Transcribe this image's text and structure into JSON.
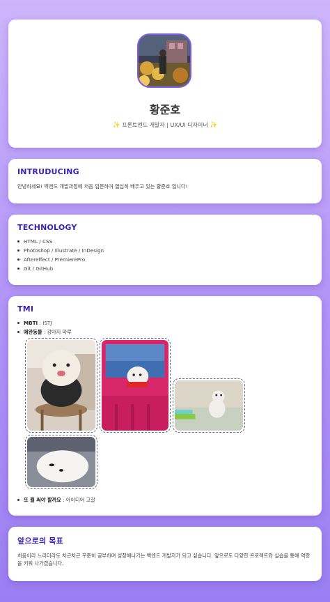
{
  "profile": {
    "name": "황준호",
    "role": "프론트엔드 개발자 | UX/UI 디자이너",
    "spark": "✨"
  },
  "intro": {
    "title": "INTRUDUCING",
    "text": "안녕하세요! 백엔드 개발과정에 처음 입문하여 열심히 배우고 있는 황준호 입니다!"
  },
  "technology": {
    "title": "TECHNOLOGY",
    "items": [
      "HTML / CSS",
      "Photoshop / Illustrate / InDesign",
      "Aftereffect / PremierePro",
      "Git / GitHub"
    ]
  },
  "tmi": {
    "title": "TMI",
    "mbti_label": "MBTI",
    "mbti_value": " : ISTJ",
    "pet_label": "애완동물",
    "pet_value": " : 강아지 마루",
    "next_label": "또 뭘 써야 할까요",
    "next_value": " : 아이디어 고갈"
  },
  "goal": {
    "title": "앞으로의 목표",
    "text": "처음이라 느리더라도 차근차근 꾸준히 공부하며 성장해나가는 백엔드 개발자가 되고 싶습니다. 앞으로도 다양한 프로젝트와 실습을 통해 역량을 키워 나가겠습니다."
  },
  "colors": {
    "accent": "#3a1fb5",
    "avatar_border": "#7b5cf0",
    "background_top": "#cdb6fb",
    "background_bottom": "#9b7ff2"
  }
}
